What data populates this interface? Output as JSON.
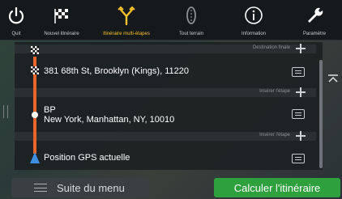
{
  "topbar": {
    "items": [
      {
        "label": "Quit",
        "icon": "power-icon"
      },
      {
        "label": "Nouvel itinéraire",
        "icon": "checkered-flag-icon"
      },
      {
        "label": "Itinéraire multi-étapes",
        "icon": "multi-stop-route-icon"
      },
      {
        "label": "Tout terrain",
        "icon": "off-road-icon"
      },
      {
        "label": "Information",
        "icon": "info-icon"
      },
      {
        "label": "Paramètre",
        "icon": "wrench-icon"
      }
    ],
    "active_index": 2
  },
  "route": {
    "separators": [
      "Destination finale",
      "Insérer l'étape",
      "Insérer l'étape"
    ],
    "stops": [
      {
        "type": "destination",
        "line1": "381 68th St, Brooklyn (Kings), 11220",
        "line2": ""
      },
      {
        "type": "waypoint",
        "line1": "BP",
        "line2": "New York, Manhattan, NY, 10010"
      },
      {
        "type": "start",
        "line1": "Position GPS actuelle",
        "line2": ""
      }
    ]
  },
  "bottom": {
    "menu_label": "Suite du menu",
    "calc_label": "Calculer l'itinéraire"
  },
  "colors": {
    "accent": "#f4c22b",
    "route": "#e8652a",
    "calc_button": "#2fa03e",
    "gps": "#3d8fe0"
  }
}
